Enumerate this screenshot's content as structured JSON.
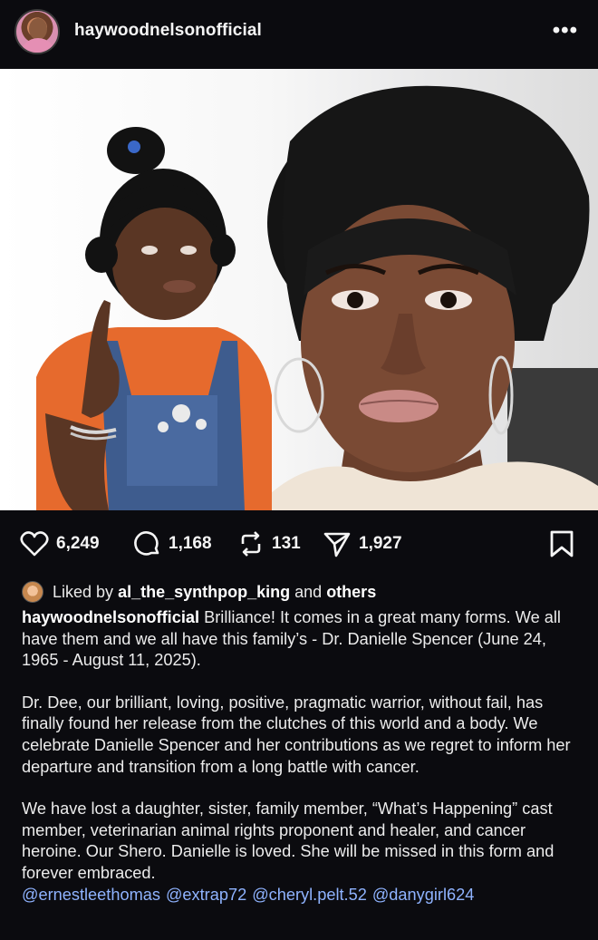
{
  "header": {
    "username": "haywoodnelsonofficial",
    "more_label": "•••"
  },
  "post": {
    "counts": {
      "likes": "6,249",
      "comments": "1,168",
      "reposts": "131",
      "shares": "1,927"
    },
    "liked_by": {
      "prefix": "Liked by",
      "user": "al_the_synthpop_king",
      "connector": "and",
      "others": "others"
    },
    "caption": {
      "username": "haywoodnelsonofficial",
      "para1": "Brilliance! It comes in a great many forms. We all have them and we all have this family’s - Dr. Danielle Spencer (June 24, 1965 - August 11, 2025).",
      "para2": "Dr. Dee, our brilliant, loving, positive, pragmatic warrior, without fail, has finally found her release from the clutches of this world and a body. We celebrate Danielle Spencer and her contributions as we regret to inform her departure and transition from a long battle with cancer.",
      "para3": "We have lost a daughter, sister, family member, “What’s Happening” cast member, veterinarian animal rights proponent and healer, and cancer heroine. Our Shero. Danielle is loved. She will be missed in this form and forever embraced.",
      "mentions": [
        "@ernestleethomas",
        "@extrap72",
        "@cheryl.pelt.52",
        "@danygirl624"
      ]
    }
  },
  "icons": {
    "like": "heart-icon",
    "comment": "comment-icon",
    "repost": "repost-icon",
    "share": "send-icon",
    "save": "bookmark-icon"
  },
  "colors": {
    "background": "#0b0b0f",
    "text": "#f2f2f2",
    "mention": "#8fb3ff"
  }
}
